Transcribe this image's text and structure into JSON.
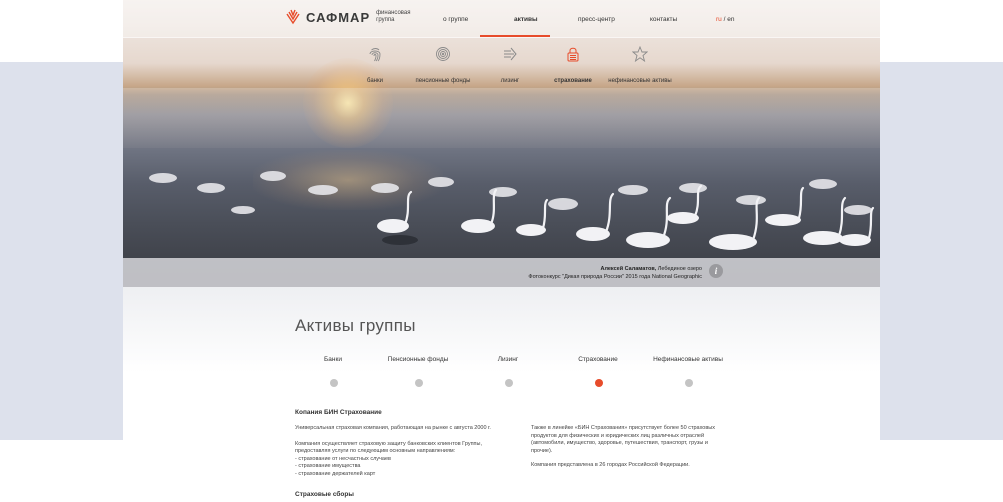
{
  "brand": {
    "name": "САФМАР",
    "subtitle": "финансовая группа",
    "accent_color": "#e74c2b"
  },
  "top_nav": [
    {
      "label": "о группе",
      "active": false
    },
    {
      "label": "активы",
      "active": true
    },
    {
      "label": "пресс-центр",
      "active": false
    },
    {
      "label": "контакты",
      "active": false
    }
  ],
  "lang": {
    "ru": "ru",
    "separator": " / ",
    "en": "en"
  },
  "sub_nav": [
    {
      "label": "банки",
      "icon": "fingerprint-icon"
    },
    {
      "label": "пенсионные фонды",
      "icon": "spiral-icon"
    },
    {
      "label": "лизинг",
      "icon": "arrow-right-icon"
    },
    {
      "label": "страхование",
      "icon": "lock-icon",
      "active": true
    },
    {
      "label": "нефинансовые активы",
      "icon": "star-icon"
    }
  ],
  "photo_caption": {
    "author": "Алексей Саламатов,",
    "place": " Лебединое озеро",
    "contest": "Фотоконкурс \"Дикая природа России\" 2015 года National Geographic"
  },
  "info_label": "i",
  "section_title": "Активы группы",
  "tabs": [
    {
      "label": "Банки",
      "active": false
    },
    {
      "label": "Пенсионные фонды",
      "active": false
    },
    {
      "label": "Лизинг",
      "active": false
    },
    {
      "label": "Страхование",
      "active": true
    },
    {
      "label": "Нефинансовые активы",
      "active": false
    }
  ],
  "company": {
    "title": "Копания БИН Страхование",
    "left": {
      "p1": "Универсальная страховая компания, работающая на рынке с августа 2000 г.",
      "p2_l1": "Компания осуществляет страховую защиту банковских клиентов Группы,",
      "p2_l2": "предоставляя услуги по следующим основным направлениям:",
      "p2_l3": "- страхование от несчастных случаев",
      "p2_l4": "- страхование имущества",
      "p2_l5": "- страхование держателей карт"
    },
    "right": {
      "p1_l1": "Также в линейке «БИН Страхования» присутствует более 50 страховых",
      "p1_l2": "продуктов для физических и юридических лиц различных отраслей",
      "p1_l3": "(автомобили, имущество, здоровье, путешествия, транспорт, грузы и",
      "p1_l4": "прочие).",
      "p2": "Компания представлена в 26 городах Российской Федерации."
    }
  },
  "next_title": "Страховые сборы"
}
